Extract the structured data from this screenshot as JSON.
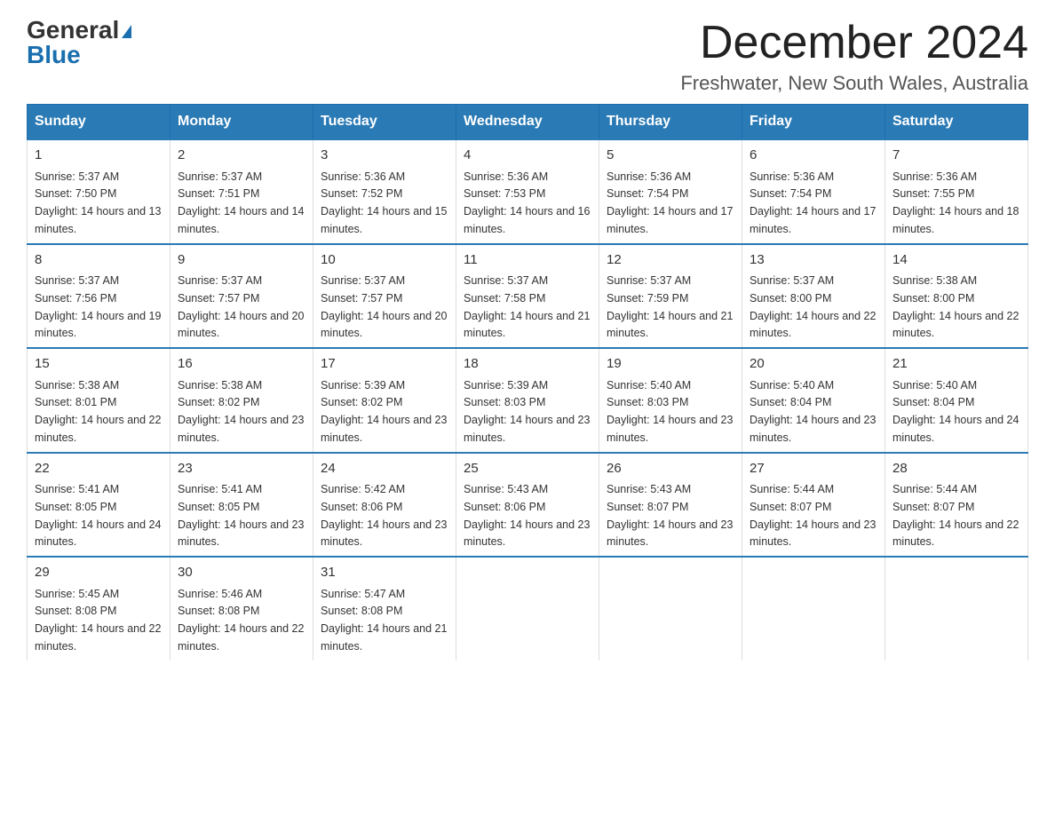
{
  "logo": {
    "part1": "General",
    "part2": "Blue"
  },
  "header": {
    "month": "December 2024",
    "location": "Freshwater, New South Wales, Australia"
  },
  "weekdays": [
    "Sunday",
    "Monday",
    "Tuesday",
    "Wednesday",
    "Thursday",
    "Friday",
    "Saturday"
  ],
  "weeks": [
    [
      {
        "day": "1",
        "sunrise": "5:37 AM",
        "sunset": "7:50 PM",
        "daylight": "14 hours and 13 minutes."
      },
      {
        "day": "2",
        "sunrise": "5:37 AM",
        "sunset": "7:51 PM",
        "daylight": "14 hours and 14 minutes."
      },
      {
        "day": "3",
        "sunrise": "5:36 AM",
        "sunset": "7:52 PM",
        "daylight": "14 hours and 15 minutes."
      },
      {
        "day": "4",
        "sunrise": "5:36 AM",
        "sunset": "7:53 PM",
        "daylight": "14 hours and 16 minutes."
      },
      {
        "day": "5",
        "sunrise": "5:36 AM",
        "sunset": "7:54 PM",
        "daylight": "14 hours and 17 minutes."
      },
      {
        "day": "6",
        "sunrise": "5:36 AM",
        "sunset": "7:54 PM",
        "daylight": "14 hours and 17 minutes."
      },
      {
        "day": "7",
        "sunrise": "5:36 AM",
        "sunset": "7:55 PM",
        "daylight": "14 hours and 18 minutes."
      }
    ],
    [
      {
        "day": "8",
        "sunrise": "5:37 AM",
        "sunset": "7:56 PM",
        "daylight": "14 hours and 19 minutes."
      },
      {
        "day": "9",
        "sunrise": "5:37 AM",
        "sunset": "7:57 PM",
        "daylight": "14 hours and 20 minutes."
      },
      {
        "day": "10",
        "sunrise": "5:37 AM",
        "sunset": "7:57 PM",
        "daylight": "14 hours and 20 minutes."
      },
      {
        "day": "11",
        "sunrise": "5:37 AM",
        "sunset": "7:58 PM",
        "daylight": "14 hours and 21 minutes."
      },
      {
        "day": "12",
        "sunrise": "5:37 AM",
        "sunset": "7:59 PM",
        "daylight": "14 hours and 21 minutes."
      },
      {
        "day": "13",
        "sunrise": "5:37 AM",
        "sunset": "8:00 PM",
        "daylight": "14 hours and 22 minutes."
      },
      {
        "day": "14",
        "sunrise": "5:38 AM",
        "sunset": "8:00 PM",
        "daylight": "14 hours and 22 minutes."
      }
    ],
    [
      {
        "day": "15",
        "sunrise": "5:38 AM",
        "sunset": "8:01 PM",
        "daylight": "14 hours and 22 minutes."
      },
      {
        "day": "16",
        "sunrise": "5:38 AM",
        "sunset": "8:02 PM",
        "daylight": "14 hours and 23 minutes."
      },
      {
        "day": "17",
        "sunrise": "5:39 AM",
        "sunset": "8:02 PM",
        "daylight": "14 hours and 23 minutes."
      },
      {
        "day": "18",
        "sunrise": "5:39 AM",
        "sunset": "8:03 PM",
        "daylight": "14 hours and 23 minutes."
      },
      {
        "day": "19",
        "sunrise": "5:40 AM",
        "sunset": "8:03 PM",
        "daylight": "14 hours and 23 minutes."
      },
      {
        "day": "20",
        "sunrise": "5:40 AM",
        "sunset": "8:04 PM",
        "daylight": "14 hours and 23 minutes."
      },
      {
        "day": "21",
        "sunrise": "5:40 AM",
        "sunset": "8:04 PM",
        "daylight": "14 hours and 24 minutes."
      }
    ],
    [
      {
        "day": "22",
        "sunrise": "5:41 AM",
        "sunset": "8:05 PM",
        "daylight": "14 hours and 24 minutes."
      },
      {
        "day": "23",
        "sunrise": "5:41 AM",
        "sunset": "8:05 PM",
        "daylight": "14 hours and 23 minutes."
      },
      {
        "day": "24",
        "sunrise": "5:42 AM",
        "sunset": "8:06 PM",
        "daylight": "14 hours and 23 minutes."
      },
      {
        "day": "25",
        "sunrise": "5:43 AM",
        "sunset": "8:06 PM",
        "daylight": "14 hours and 23 minutes."
      },
      {
        "day": "26",
        "sunrise": "5:43 AM",
        "sunset": "8:07 PM",
        "daylight": "14 hours and 23 minutes."
      },
      {
        "day": "27",
        "sunrise": "5:44 AM",
        "sunset": "8:07 PM",
        "daylight": "14 hours and 23 minutes."
      },
      {
        "day": "28",
        "sunrise": "5:44 AM",
        "sunset": "8:07 PM",
        "daylight": "14 hours and 22 minutes."
      }
    ],
    [
      {
        "day": "29",
        "sunrise": "5:45 AM",
        "sunset": "8:08 PM",
        "daylight": "14 hours and 22 minutes."
      },
      {
        "day": "30",
        "sunrise": "5:46 AM",
        "sunset": "8:08 PM",
        "daylight": "14 hours and 22 minutes."
      },
      {
        "day": "31",
        "sunrise": "5:47 AM",
        "sunset": "8:08 PM",
        "daylight": "14 hours and 21 minutes."
      },
      null,
      null,
      null,
      null
    ]
  ],
  "labels": {
    "sunrise_prefix": "Sunrise: ",
    "sunset_prefix": "Sunset: ",
    "daylight_prefix": "Daylight: "
  }
}
